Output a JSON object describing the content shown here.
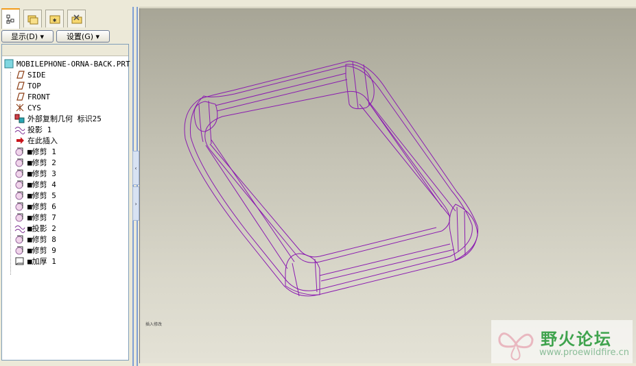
{
  "tabs": [
    {
      "name": "model-tree-tab"
    },
    {
      "name": "layer-tab"
    },
    {
      "name": "favorites-tab"
    },
    {
      "name": "tools-tab"
    }
  ],
  "toolbar": {
    "show_label": "显示(D) ▾",
    "settings_label": "设置(G) ▾"
  },
  "tree": {
    "root": "MOBILEPHONE-ORNA-BACK.PRT",
    "items": [
      {
        "label": "SIDE",
        "icon": "datum-plane-icon"
      },
      {
        "label": "TOP",
        "icon": "datum-plane-icon"
      },
      {
        "label": "FRONT",
        "icon": "datum-plane-icon"
      },
      {
        "label": "CYS",
        "icon": "coordinate-system-icon"
      },
      {
        "label": "外部复制几何 标识25",
        "icon": "external-copy-geometry-icon"
      },
      {
        "label": "投影 1",
        "icon": "projection-icon"
      },
      {
        "label": "在此插入",
        "icon": "insert-here-arrow-icon"
      },
      {
        "label": "■修剪 1",
        "icon": "trim-icon"
      },
      {
        "label": "■修剪 2",
        "icon": "trim-icon"
      },
      {
        "label": "■修剪 3",
        "icon": "trim-icon"
      },
      {
        "label": "■修剪 4",
        "icon": "trim-icon"
      },
      {
        "label": "■修剪 5",
        "icon": "trim-icon"
      },
      {
        "label": "■修剪 6",
        "icon": "trim-icon"
      },
      {
        "label": "■修剪 7",
        "icon": "trim-icon"
      },
      {
        "label": "■投影 2",
        "icon": "projection-icon"
      },
      {
        "label": "■修剪 8",
        "icon": "trim-icon"
      },
      {
        "label": "■修剪 9",
        "icon": "trim-icon"
      },
      {
        "label": "■加厚 1",
        "icon": "thicken-icon"
      }
    ]
  },
  "viewport": {
    "model_color": "#8a1ab0",
    "label": "插入修改"
  },
  "watermark": {
    "title": "野火论坛",
    "url": "www.proewildfire.cn"
  }
}
